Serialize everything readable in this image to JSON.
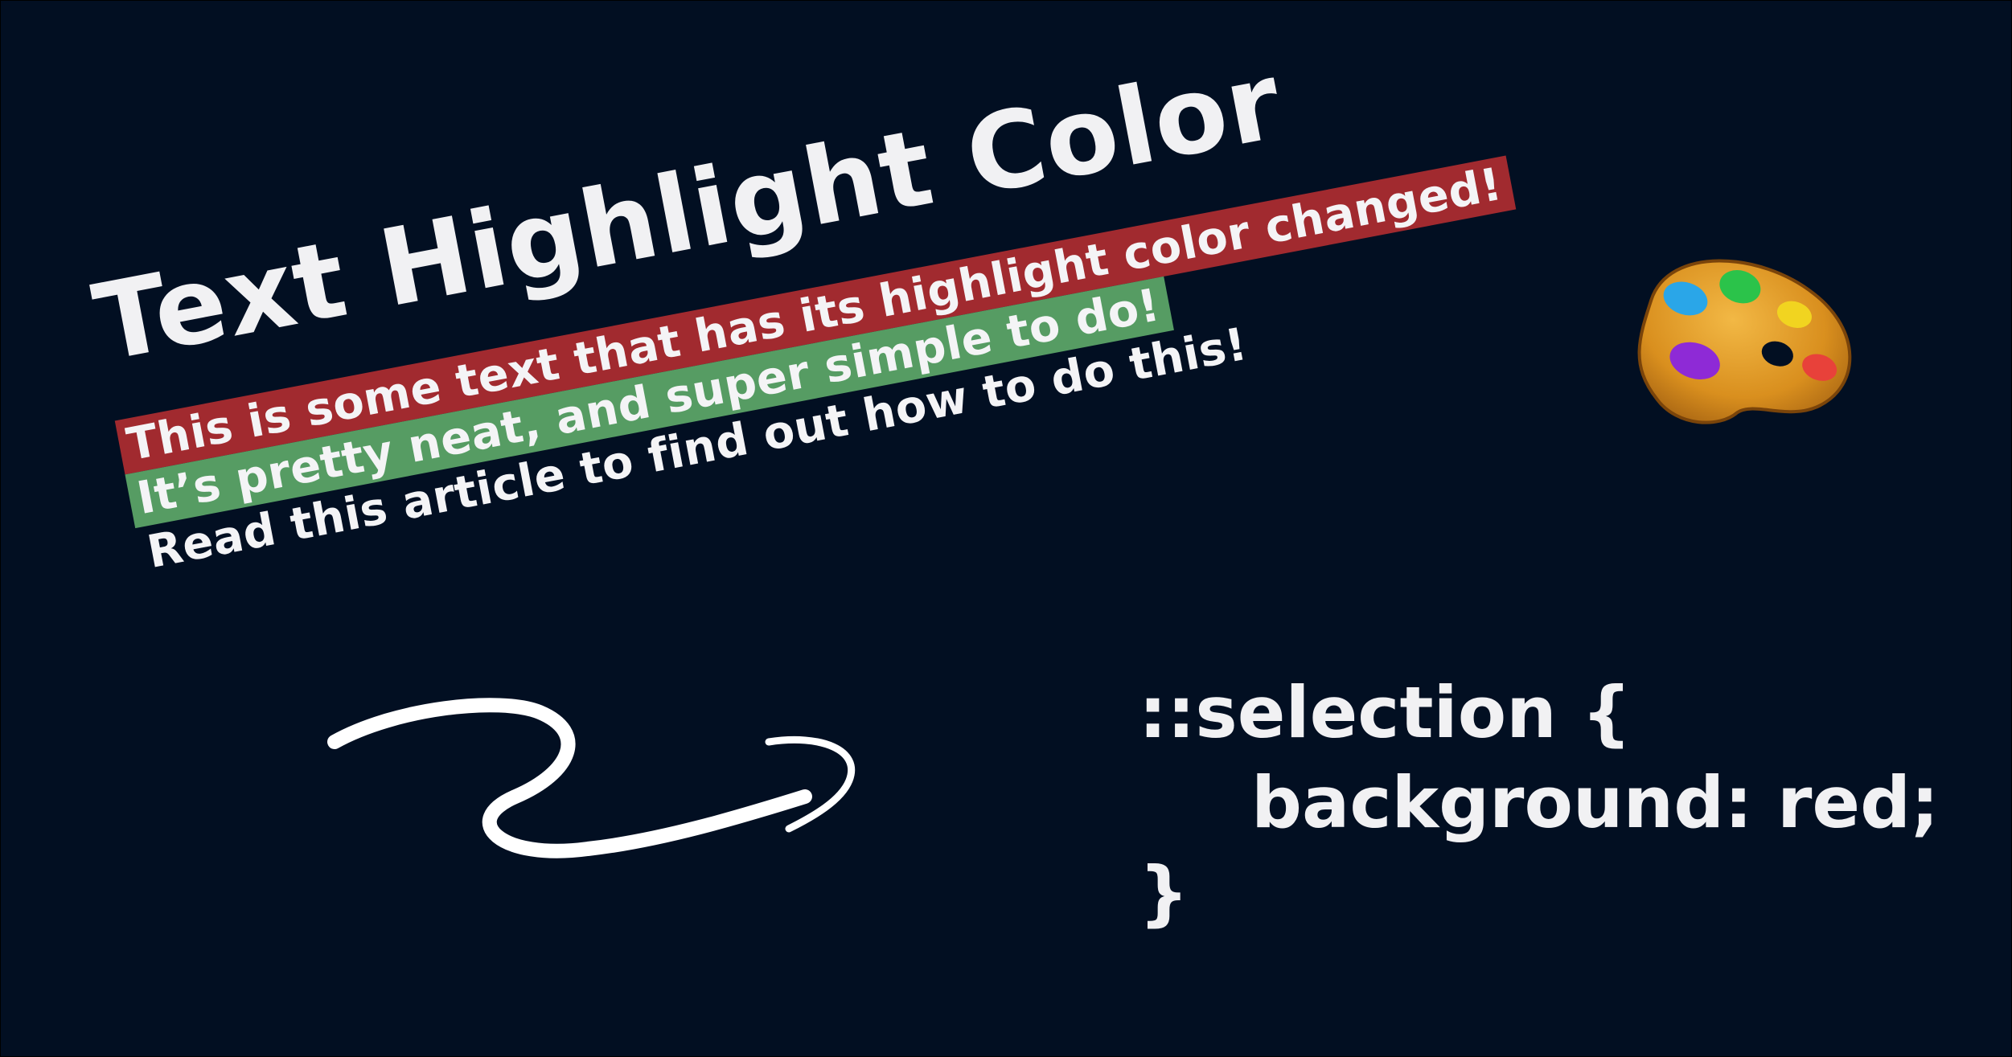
{
  "title": "Text Highlight Color",
  "lines": [
    "This is some text that has its highlight color changed!",
    "It’s pretty neat, and super simple to do!",
    "Read this article to find out how to do this!"
  ],
  "code": {
    "line1": "::selection {",
    "line2": "background: red;",
    "line3": "}"
  },
  "colors": {
    "background": "#020f22",
    "highlight_red": "#a12a2f",
    "highlight_green": "#569c63",
    "text": "#f1f1f3"
  },
  "icons": {
    "palette": "artist-palette-icon",
    "arrow": "hand-drawn-arrow-icon"
  }
}
